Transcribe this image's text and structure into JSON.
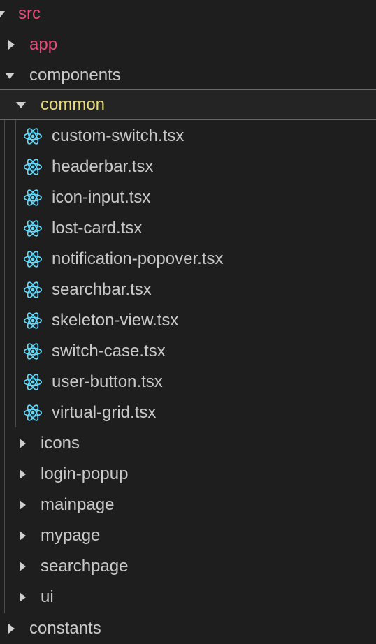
{
  "explorer": {
    "colors": {
      "git_modified_folder": "#e84a79",
      "active_folder": "#e6db74",
      "default_text": "#c9c9c9",
      "react_icon": "#61dafb"
    },
    "icons": {
      "file_icon": "react-icon",
      "collapsed_twisty": "chevron-right-icon",
      "expanded_twisty": "chevron-down-icon"
    },
    "src": "src",
    "app": "app",
    "components": "components",
    "common": "common",
    "files": [
      "custom-switch.tsx",
      "headerbar.tsx",
      "icon-input.tsx",
      "lost-card.tsx",
      "notification-popover.tsx",
      "searchbar.tsx",
      "skeleton-view.tsx",
      "switch-case.tsx",
      "user-button.tsx",
      "virtual-grid.tsx"
    ],
    "subfolders": [
      "icons",
      "login-popup",
      "mainpage",
      "mypage",
      "searchpage",
      "ui"
    ],
    "constants": "constants"
  }
}
